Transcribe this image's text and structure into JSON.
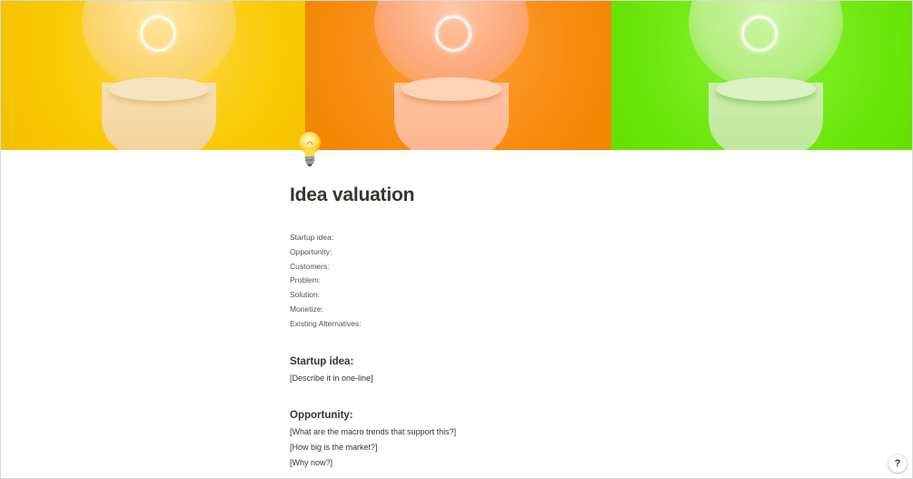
{
  "page": {
    "title": "Idea valuation",
    "icon": "lightbulb-icon"
  },
  "cover": {
    "panels": [
      {
        "color": "#f9c900"
      },
      {
        "color": "#f78c10"
      },
      {
        "color": "#6fe80e"
      }
    ]
  },
  "properties": [
    "Startup idea:",
    "Opportunity:",
    "Customers:",
    "Problem:",
    "Solution:",
    "Monetize:",
    "Existing Alternatives:"
  ],
  "sections": [
    {
      "heading": "Startup idea:",
      "lines": [
        "[Describe it in one-line]"
      ]
    },
    {
      "heading": "Opportunity:",
      "lines": [
        "[What are the macro trends that support this?]",
        "[How big is the market?]",
        "[Why now?]"
      ]
    }
  ],
  "help": {
    "label": "?"
  }
}
